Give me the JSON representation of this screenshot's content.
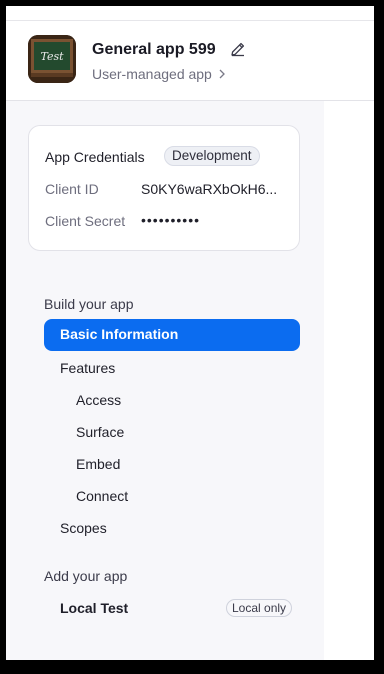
{
  "header": {
    "app_title": "General app 599",
    "subtitle": "User-managed app",
    "app_icon_text": "Test",
    "edit_icon": "pencil-icon",
    "subtitle_icon": "chevron-right-icon"
  },
  "credentials": {
    "title": "App Credentials",
    "badge": "Development",
    "client_id_label": "Client ID",
    "client_id_value": "S0KY6waRXbOkH6...",
    "client_secret_label": "Client Secret",
    "client_secret_value": "••••••••••"
  },
  "nav": {
    "build_title": "Build your app",
    "basic_information": "Basic Information",
    "features": "Features",
    "access": "Access",
    "surface": "Surface",
    "embed": "Embed",
    "connect": "Connect",
    "scopes": "Scopes",
    "add_title": "Add your app",
    "local_test": "Local Test",
    "local_only_badge": "Local only"
  },
  "colors": {
    "accent": "#0b6cf0",
    "sidebar_bg": "#f7f7fa"
  }
}
